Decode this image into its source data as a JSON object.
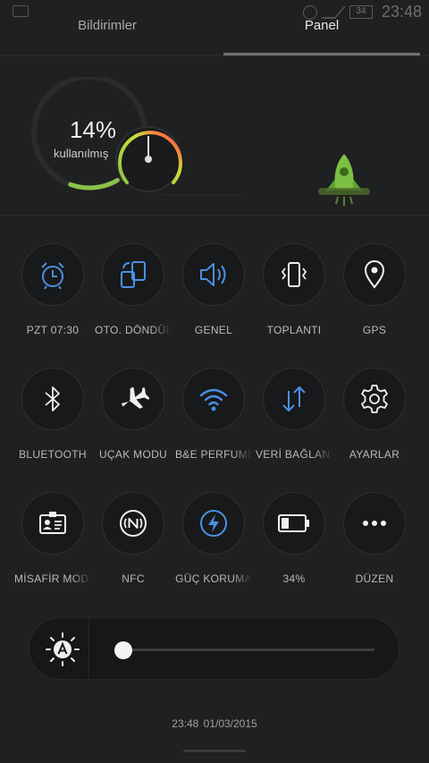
{
  "status_bar": {
    "time": "23:48",
    "battery": "34"
  },
  "tabs": [
    {
      "label": "Bildirimler"
    },
    {
      "label": "Panel"
    }
  ],
  "memory": {
    "percent": "14%",
    "label": "kullanılmış",
    "usage_fraction": 0.14
  },
  "toggles": [
    {
      "label": "PZT 07:30",
      "icon": "alarm-icon",
      "active": true
    },
    {
      "label": "OTO. DÖNDÜR",
      "icon": "auto-rotate-icon",
      "active": true
    },
    {
      "label": "GENEL",
      "icon": "volume-icon",
      "active": true
    },
    {
      "label": "TOPLANTI",
      "icon": "vibrate-icon",
      "active": false
    },
    {
      "label": "GPS",
      "icon": "location-pin-icon",
      "active": false
    },
    {
      "label": "BLUETOOTH",
      "icon": "bluetooth-icon",
      "active": false
    },
    {
      "label": "UÇAK MODU",
      "icon": "airplane-icon",
      "active": false
    },
    {
      "label": "B&E PERFUME",
      "icon": "wifi-icon",
      "active": true
    },
    {
      "label": "VERİ BAĞLANTISI",
      "icon": "data-transfer-icon",
      "active": true
    },
    {
      "label": "AYARLAR",
      "icon": "gear-icon",
      "active": false
    },
    {
      "label": "MİSAFİR MODU",
      "icon": "guest-badge-icon",
      "active": false
    },
    {
      "label": "NFC",
      "icon": "nfc-icon",
      "active": false
    },
    {
      "label": "GÜÇ KORUMA",
      "icon": "power-saving-icon",
      "active": true
    },
    {
      "label": "34%",
      "icon": "battery-icon",
      "active": false
    },
    {
      "label": "DÜZEN",
      "icon": "more-icon",
      "active": false
    }
  ],
  "brightness": {
    "icon": "auto-brightness-icon",
    "level": 0.03
  },
  "footer": {
    "datetime": "23:48  01/03/2015"
  },
  "colors": {
    "accent": "#4a90e2",
    "gauge_green": "#8bc34a",
    "gauge_red": "#e53935",
    "rocket_green": "#7cc043"
  }
}
